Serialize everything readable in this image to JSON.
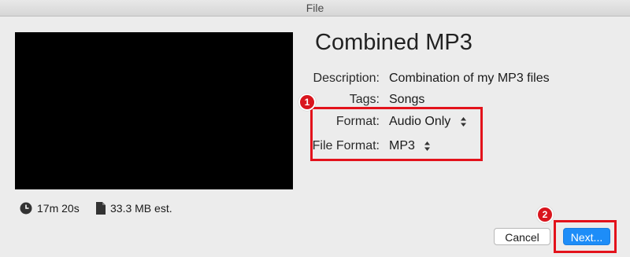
{
  "window": {
    "title": "File"
  },
  "stats": {
    "duration": "17m 20s",
    "size": "33.3 MB est."
  },
  "details": {
    "title": "Combined MP3",
    "description_label": "Description:",
    "description_value": "Combination of my MP3 files",
    "tags_label": "Tags:",
    "tags_value": "Songs",
    "format_label": "Format:",
    "format_value": "Audio Only",
    "file_format_label": "File Format:",
    "file_format_value": "MP3"
  },
  "annotations": {
    "step1": "1",
    "step2": "2",
    "highlight_color": "#e3121b"
  },
  "buttons": {
    "cancel": "Cancel",
    "next": "Next..."
  },
  "colors": {
    "accent": "#1d8df8",
    "window_bg": "#ececec"
  }
}
